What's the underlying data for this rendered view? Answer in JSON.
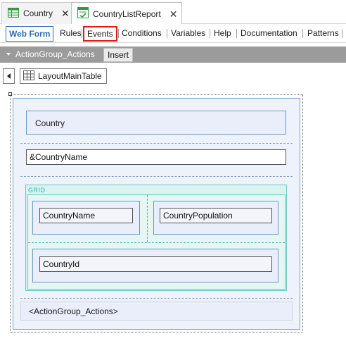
{
  "doc_tabs": [
    {
      "label": "Country",
      "close": "✕"
    },
    {
      "label": "CountryListReport",
      "close": "✕"
    }
  ],
  "part_tabs": {
    "web_form": "Web Form",
    "rules": "Rules",
    "events": "Events",
    "conditions": "Conditions",
    "variables": "Variables",
    "help": "Help",
    "documentation": "Documentation",
    "patterns": "Patterns"
  },
  "action_group": {
    "title": "ActionGroup_Actions",
    "insert": "Insert"
  },
  "breadcrumb": {
    "item": "LayoutMainTable"
  },
  "form": {
    "country_label": "Country",
    "country_name_var": "&CountryName",
    "grid_caption": "GRID",
    "grid_country_name": "CountryName",
    "grid_country_population": "CountryPopulation",
    "grid_country_id": "CountryId",
    "action_group_ref": "<ActionGroup_Actions>"
  },
  "colors": {
    "selected_tab": "#2a6eb5",
    "highlight_border": "#e0191b",
    "grid_accent": "#39b7b1"
  }
}
